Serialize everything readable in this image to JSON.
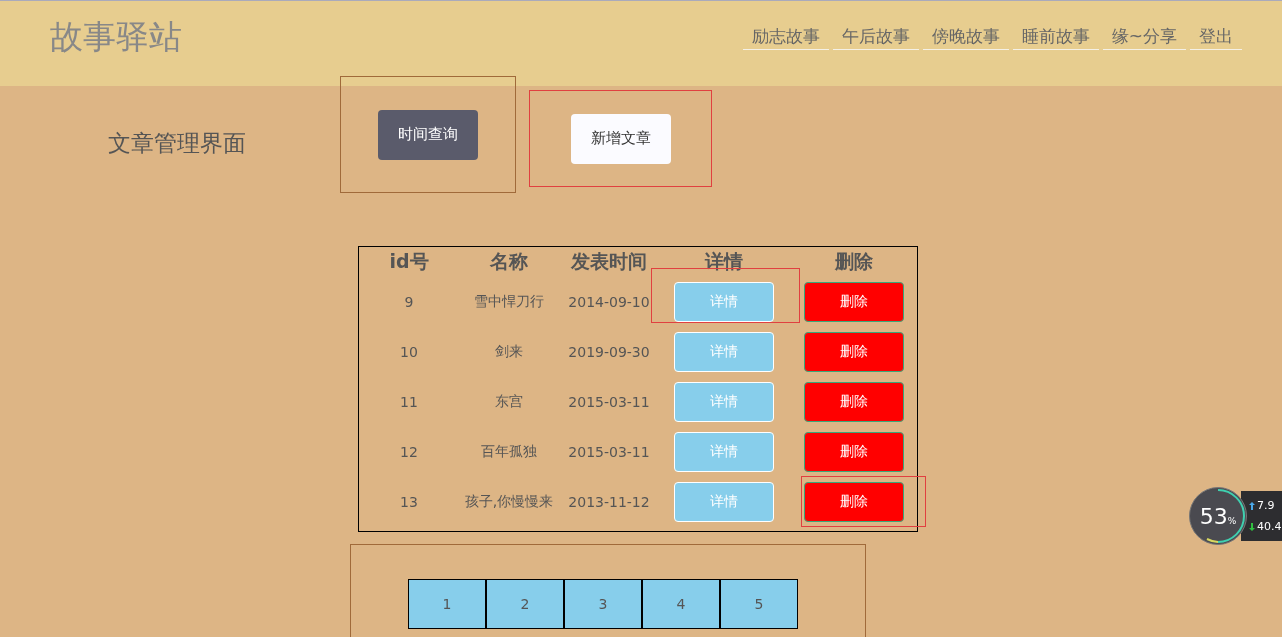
{
  "site_title": "故事驿站",
  "nav": [
    "励志故事",
    "午后故事",
    "傍晚故事",
    "睡前故事",
    "缘~分享",
    "登出"
  ],
  "page_heading": "文章管理界面",
  "actions": [
    {
      "label": "时间查询",
      "kind": "dark"
    },
    {
      "label": "新增文章",
      "kind": "light"
    }
  ],
  "table": {
    "columns": [
      "id号",
      "名称",
      "发表时间",
      "详情",
      "删除"
    ],
    "rows": [
      {
        "id": "9",
        "name": "雪中悍刀行",
        "date": "2014-09-10",
        "detail": "详情",
        "delete": "删除",
        "detail_outlined": true,
        "delete_outlined": false
      },
      {
        "id": "10",
        "name": "剑来",
        "date": "2019-09-30",
        "detail": "详情",
        "delete": "删除",
        "detail_outlined": false,
        "delete_outlined": false
      },
      {
        "id": "11",
        "name": "东宫",
        "date": "2015-03-11",
        "detail": "详情",
        "delete": "删除",
        "detail_outlined": false,
        "delete_outlined": false
      },
      {
        "id": "12",
        "name": "百年孤独",
        "date": "2015-03-11",
        "detail": "详情",
        "delete": "删除",
        "detail_outlined": false,
        "delete_outlined": false
      },
      {
        "id": "13",
        "name": "孩子,你慢慢来",
        "date": "2013-11-12",
        "detail": "详情",
        "delete": "删除",
        "detail_outlined": false,
        "delete_outlined": true
      }
    ]
  },
  "pagination": [
    "1",
    "2",
    "3",
    "4",
    "5"
  ],
  "net_widget": {
    "percent": "53",
    "percent_sign": "%",
    "upload": "7.9",
    "download": "40.4"
  }
}
